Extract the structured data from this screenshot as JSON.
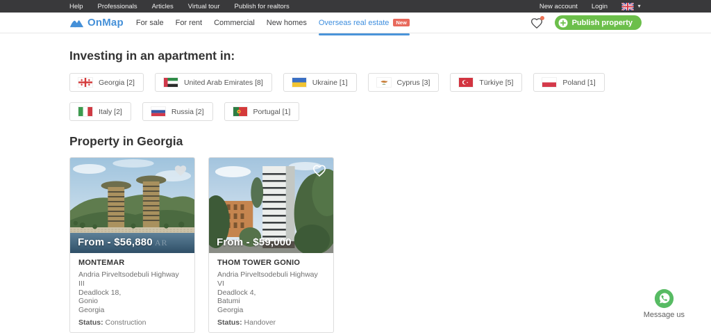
{
  "topbar": {
    "links": [
      "Help",
      "Professionals",
      "Articles",
      "Virtual tour",
      "Publish for realtors"
    ],
    "account_links": [
      "New account",
      "Login"
    ],
    "language_icon": "uk-flag-icon"
  },
  "navbar": {
    "brand": "OnMap",
    "links": [
      "For sale",
      "For rent",
      "Commercial",
      "New homes",
      "Overseas real estate"
    ],
    "active_link": "Overseas real estate",
    "new_badge": "New",
    "favorites_icon": "heart-icon",
    "publish_button": "Publish property"
  },
  "sections": {
    "invest_heading": "Investing in an apartment in:",
    "property_heading": "Property in Georgia"
  },
  "countries": [
    {
      "label": "Georgia [2]",
      "flag": "georgia-flag-icon"
    },
    {
      "label": "United Arab Emirates [8]",
      "flag": "uae-flag-icon"
    },
    {
      "label": "Ukraine [1]",
      "flag": "ukraine-flag-icon"
    },
    {
      "label": "Cyprus [3]",
      "flag": "cyprus-flag-icon"
    },
    {
      "label": "Türkiye [5]",
      "flag": "turkiye-flag-icon"
    },
    {
      "label": "Poland [1]",
      "flag": "poland-flag-icon"
    },
    {
      "label": "Italy [2]",
      "flag": "italy-flag-icon"
    },
    {
      "label": "Russia [2]",
      "flag": "russia-flag-icon"
    },
    {
      "label": "Portugal [1]",
      "flag": "portugal-flag-icon"
    }
  ],
  "cards": [
    {
      "price": "From - $56,880",
      "watermark": "AR",
      "name": "MONTEMAR",
      "address_lines": [
        "Andria Pirveltsodebuli Highway III",
        "Deadlock 18,",
        "Gonio",
        "Georgia"
      ],
      "status_label": "Status:",
      "status_value": "Construction",
      "favorite_icon": "heart-filled-icon"
    },
    {
      "price": "From - $59,000",
      "watermark": "",
      "name": "THOM TOWER GONIO",
      "address_lines": [
        "Andria Pirveltsodebuli Highway VI",
        "Deadlock 4,",
        "Batumi",
        "Georgia"
      ],
      "status_label": "Status:",
      "status_value": "Handover",
      "favorite_icon": "heart-outline-icon"
    }
  ],
  "chat": {
    "label": "Message us",
    "icon": "whatsapp-icon"
  },
  "colors": {
    "accent_blue": "#3e8ede",
    "accent_green": "#6cbf4b",
    "badge_red": "#e8695c",
    "topbar_bg": "#39393b"
  }
}
